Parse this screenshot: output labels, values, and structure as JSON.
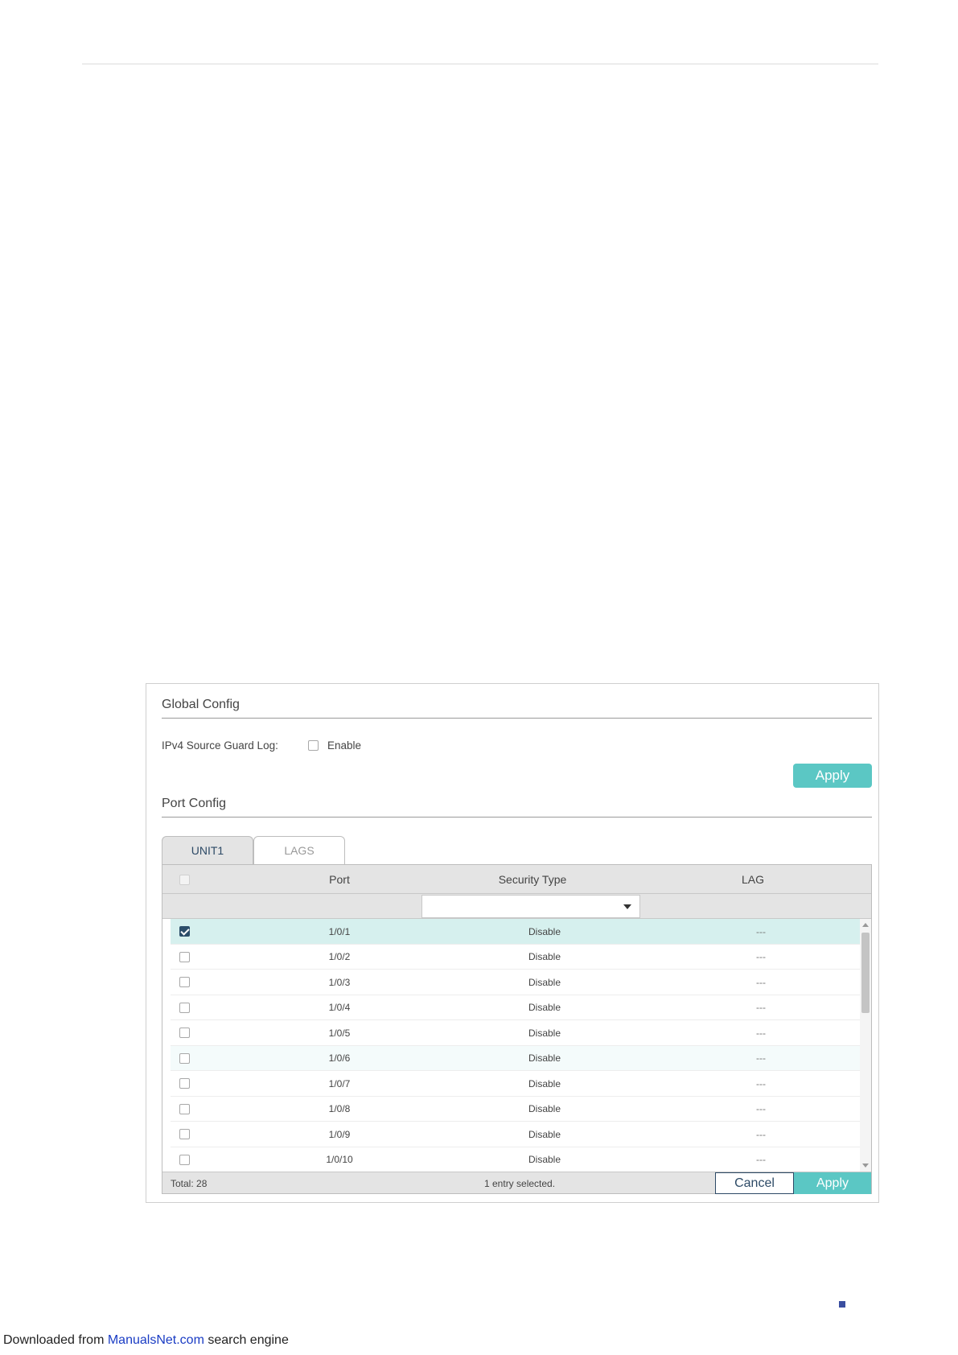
{
  "global_config": {
    "title": "Global Config",
    "log_label": "IPv4 Source Guard Log:",
    "enable_label": "Enable",
    "apply_label": "Apply"
  },
  "port_config": {
    "title": "Port Config",
    "tabs": [
      {
        "label": "UNIT1",
        "active": true
      },
      {
        "label": "LAGS",
        "active": false
      }
    ],
    "columns": {
      "port": "Port",
      "security_type": "Security Type",
      "lag": "LAG"
    },
    "filter": {
      "security_type_selected": ""
    },
    "rows": [
      {
        "port": "1/0/1",
        "security_type": "Disable",
        "lag": "---",
        "checked": true
      },
      {
        "port": "1/0/2",
        "security_type": "Disable",
        "lag": "---",
        "checked": false
      },
      {
        "port": "1/0/3",
        "security_type": "Disable",
        "lag": "---",
        "checked": false
      },
      {
        "port": "1/0/4",
        "security_type": "Disable",
        "lag": "---",
        "checked": false
      },
      {
        "port": "1/0/5",
        "security_type": "Disable",
        "lag": "---",
        "checked": false
      },
      {
        "port": "1/0/6",
        "security_type": "Disable",
        "lag": "---",
        "checked": false
      },
      {
        "port": "1/0/7",
        "security_type": "Disable",
        "lag": "---",
        "checked": false
      },
      {
        "port": "1/0/8",
        "security_type": "Disable",
        "lag": "---",
        "checked": false
      },
      {
        "port": "1/0/9",
        "security_type": "Disable",
        "lag": "---",
        "checked": false
      },
      {
        "port": "1/0/10",
        "security_type": "Disable",
        "lag": "---",
        "checked": false
      }
    ],
    "footer": {
      "total": "Total: 28",
      "selected": "1 entry selected.",
      "cancel_label": "Cancel",
      "apply_label": "Apply"
    }
  },
  "page_footer": {
    "prefix": "Downloaded from ",
    "link": "ManualsNet.com",
    "suffix": " search engine"
  },
  "colors": {
    "accent": "#5bc7c4",
    "selected_row": "#d6f0ee",
    "checkbox_checked": "#2c4e6a",
    "link": "#1a3cc4"
  }
}
